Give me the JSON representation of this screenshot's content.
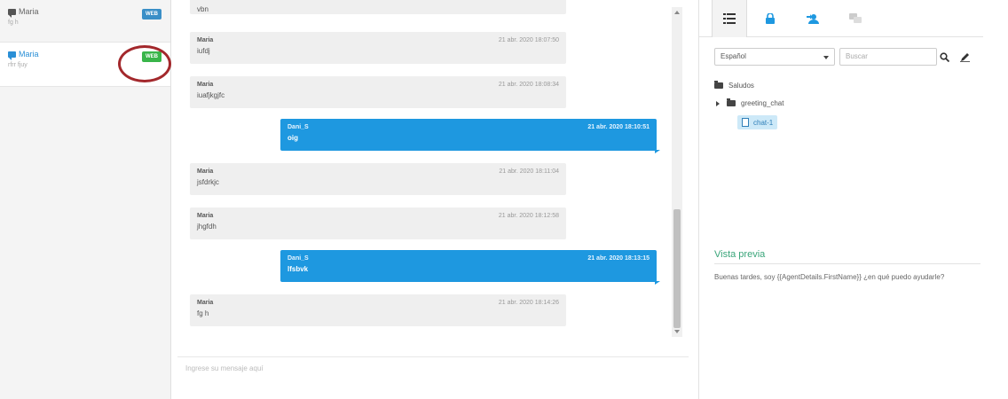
{
  "conversations": [
    {
      "name": "Maria",
      "sub": "fg h",
      "badge": "WEB",
      "badge_color": "#3a8fc7"
    },
    {
      "name": "Maria",
      "sub": "rfrr fjuy",
      "badge": "WEB",
      "badge_color": "#39b54a"
    }
  ],
  "messages": [
    {
      "direction": "in",
      "sender": "",
      "time": "",
      "text": "vbn"
    },
    {
      "direction": "in",
      "sender": "Maria",
      "time": "21 abr. 2020 18:07:50",
      "text": "iufdj"
    },
    {
      "direction": "in",
      "sender": "Maria",
      "time": "21 abr. 2020 18:08:34",
      "text": "iuafjkgjfc"
    },
    {
      "direction": "out",
      "sender": "Dani_S",
      "time": "21 abr. 2020 18:10:51",
      "text": "oig"
    },
    {
      "direction": "in",
      "sender": "Maria",
      "time": "21 abr. 2020 18:11:04",
      "text": "jsfdrkjc"
    },
    {
      "direction": "in",
      "sender": "Maria",
      "time": "21 abr. 2020 18:12:58",
      "text": "jhgfdh"
    },
    {
      "direction": "out",
      "sender": "Dani_S",
      "time": "21 abr. 2020 18:13:15",
      "text": "lfsbvk"
    },
    {
      "direction": "in",
      "sender": "Maria",
      "time": "21 abr. 2020 18:14:26",
      "text": "fg h"
    }
  ],
  "compose": {
    "placeholder": "Ingrese su mensaje aquí"
  },
  "side": {
    "tabs": [
      {
        "icon": "list-icon",
        "active": true
      },
      {
        "icon": "lock-icon",
        "active": false
      },
      {
        "icon": "user-transfer-icon",
        "active": false
      },
      {
        "icon": "chat-history-icon",
        "active": false
      }
    ],
    "language": "Español",
    "search_placeholder": "Buscar",
    "tree": {
      "root": "Saludos",
      "child": "greeting_chat",
      "leaf": "chat-1"
    },
    "preview_title": "Vista previa",
    "preview_text": "Buenas tardes, soy {{AgentDetails.FirstName}} ¿en qué puedo ayudarle?"
  },
  "colors": {
    "accent": "#1e98e0",
    "highlight_ring": "#a3282c",
    "preview_title": "#3aa57a"
  }
}
